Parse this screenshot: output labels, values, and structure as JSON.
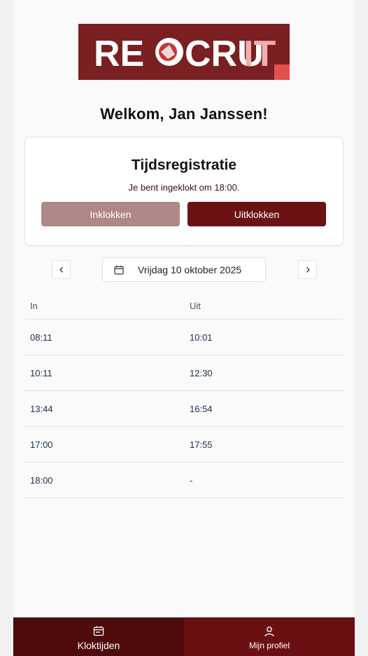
{
  "logo": {
    "text_left": "RE",
    "text_mid": "CRU",
    "text_right": "IT",
    "bg_color": "#7a1f22",
    "accent_color": "#e35050"
  },
  "welcome": "Welkom, Jan Janssen!",
  "time_card": {
    "title": "Tijdsregistratie",
    "status": "Je bent ingeklokt om 18:00.",
    "clock_in_label": "Inklokken",
    "clock_out_label": "Uitklokken",
    "clock_in_enabled": false
  },
  "date_nav": {
    "prev_icon": "chevron-left-icon",
    "next_icon": "chevron-right-icon",
    "calendar_icon": "calendar-icon",
    "date": "Vrijdag 10 oktober 2025"
  },
  "table": {
    "headers": {
      "in": "In",
      "out": "Uit"
    },
    "rows": [
      {
        "in": "08:11",
        "out": "10:01"
      },
      {
        "in": "10:11",
        "out": "12:30"
      },
      {
        "in": "13:44",
        "out": "16:54"
      },
      {
        "in": "17:00",
        "out": "17:55"
      },
      {
        "in": "18:00",
        "out": "-"
      }
    ]
  },
  "tabbar": {
    "tabs": [
      {
        "label": "Kloktijden",
        "icon": "calendar-icon",
        "active": true
      },
      {
        "label": "Mijn profiel",
        "icon": "user-icon",
        "active": false
      }
    ]
  },
  "colors": {
    "primary": "#6b1114",
    "primary_disabled": "#ad8887",
    "tab_active": "#4f0a0c",
    "tab_inactive": "#6a1013"
  }
}
